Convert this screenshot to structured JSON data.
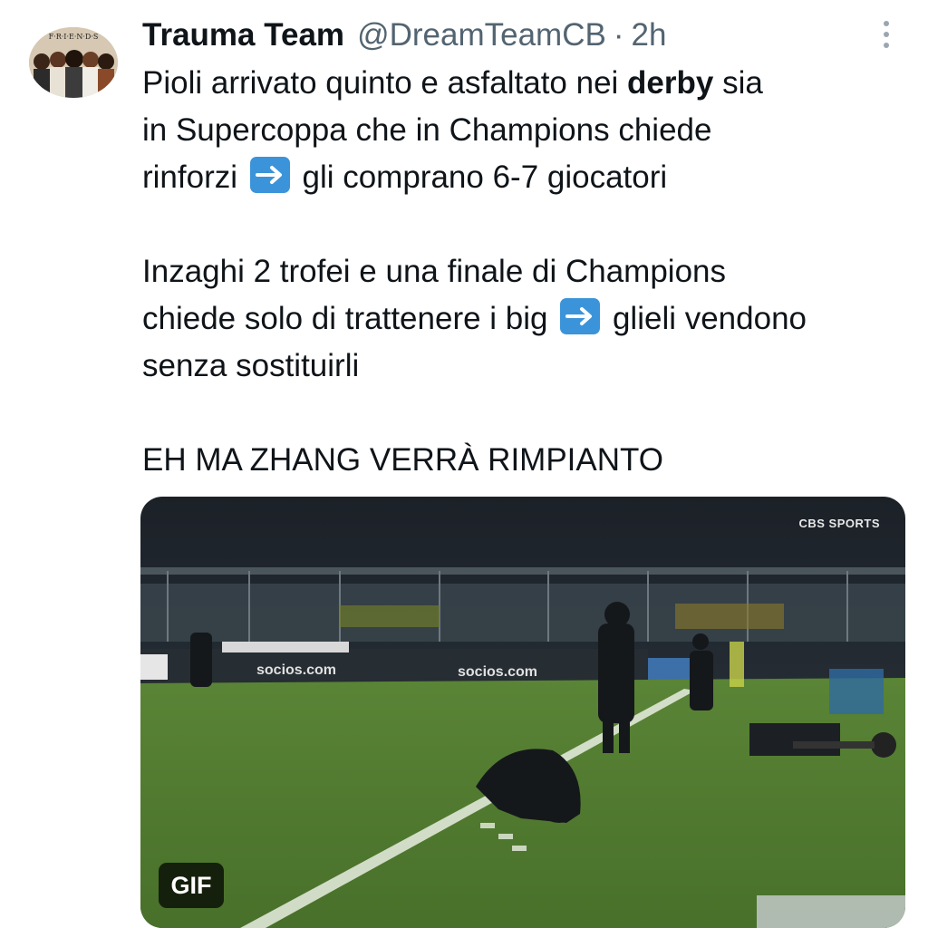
{
  "tweet": {
    "author_name": "Trauma Team",
    "handle": "@DreamTeamCB",
    "separator": "·",
    "time": "2h",
    "avatar_text": "F·R·I·E·N·D·S",
    "paragraphs": [
      {
        "line1_a": "Pioli arrivato quinto e asfaltato nei ",
        "line1_bold": "derby",
        "line1_b": " sia",
        "line2": "in Supercoppa che in Champions chiede",
        "line3_a": "rinforzi ",
        "line3_b": " gli comprano 6-7 giocatori"
      },
      {
        "line1": "Inzaghi 2 trofei e una finale di Champions",
        "line2_a": "chiede solo di trattenere i big ",
        "line2_b": " glieli vendono",
        "line3": "senza sostituirli"
      },
      {
        "line1": "EH MA ZHANG VERRÀ RIMPIANTO"
      }
    ],
    "media": {
      "badge": "GIF",
      "broadcaster": "CBS SPORTS",
      "ad_text_1": "socios.com",
      "ad_text_2": "socios.com"
    }
  },
  "icons": {
    "more": "more-vertical-icon",
    "arrow": "right-arrow-emoji-icon"
  },
  "colors": {
    "text": "#0f1419",
    "secondary": "#536471",
    "arrow_emoji": "#3b94d9",
    "pitch": "#4f7a2e"
  }
}
